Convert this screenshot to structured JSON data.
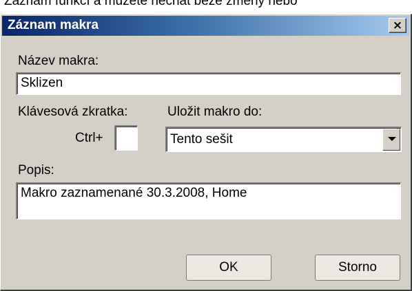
{
  "background_text": "Záznam funkcí a můžete nechat beze změny nebo",
  "dialog": {
    "title": "Záznam makra",
    "close_symbol": "×"
  },
  "macro_name": {
    "label": "Název makra:",
    "value": "Sklizen"
  },
  "shortcut": {
    "label": "Klávesová zkratka:",
    "prefix": "Ctrl+",
    "value": ""
  },
  "store_in": {
    "label": "Uložit makro do:",
    "selected": "Tento sešit"
  },
  "description": {
    "label": "Popis:",
    "value": "Makro zaznamenané 30.3.2008, Home"
  },
  "buttons": {
    "ok": "OK",
    "cancel": "Storno"
  },
  "icons": {
    "close": "close-icon",
    "dropdown": "chevron-down-icon"
  },
  "colors": {
    "dialog_bg": "#d4d0c8",
    "title_gradient_start": "#0a246a",
    "title_gradient_end": "#a6caf0"
  }
}
